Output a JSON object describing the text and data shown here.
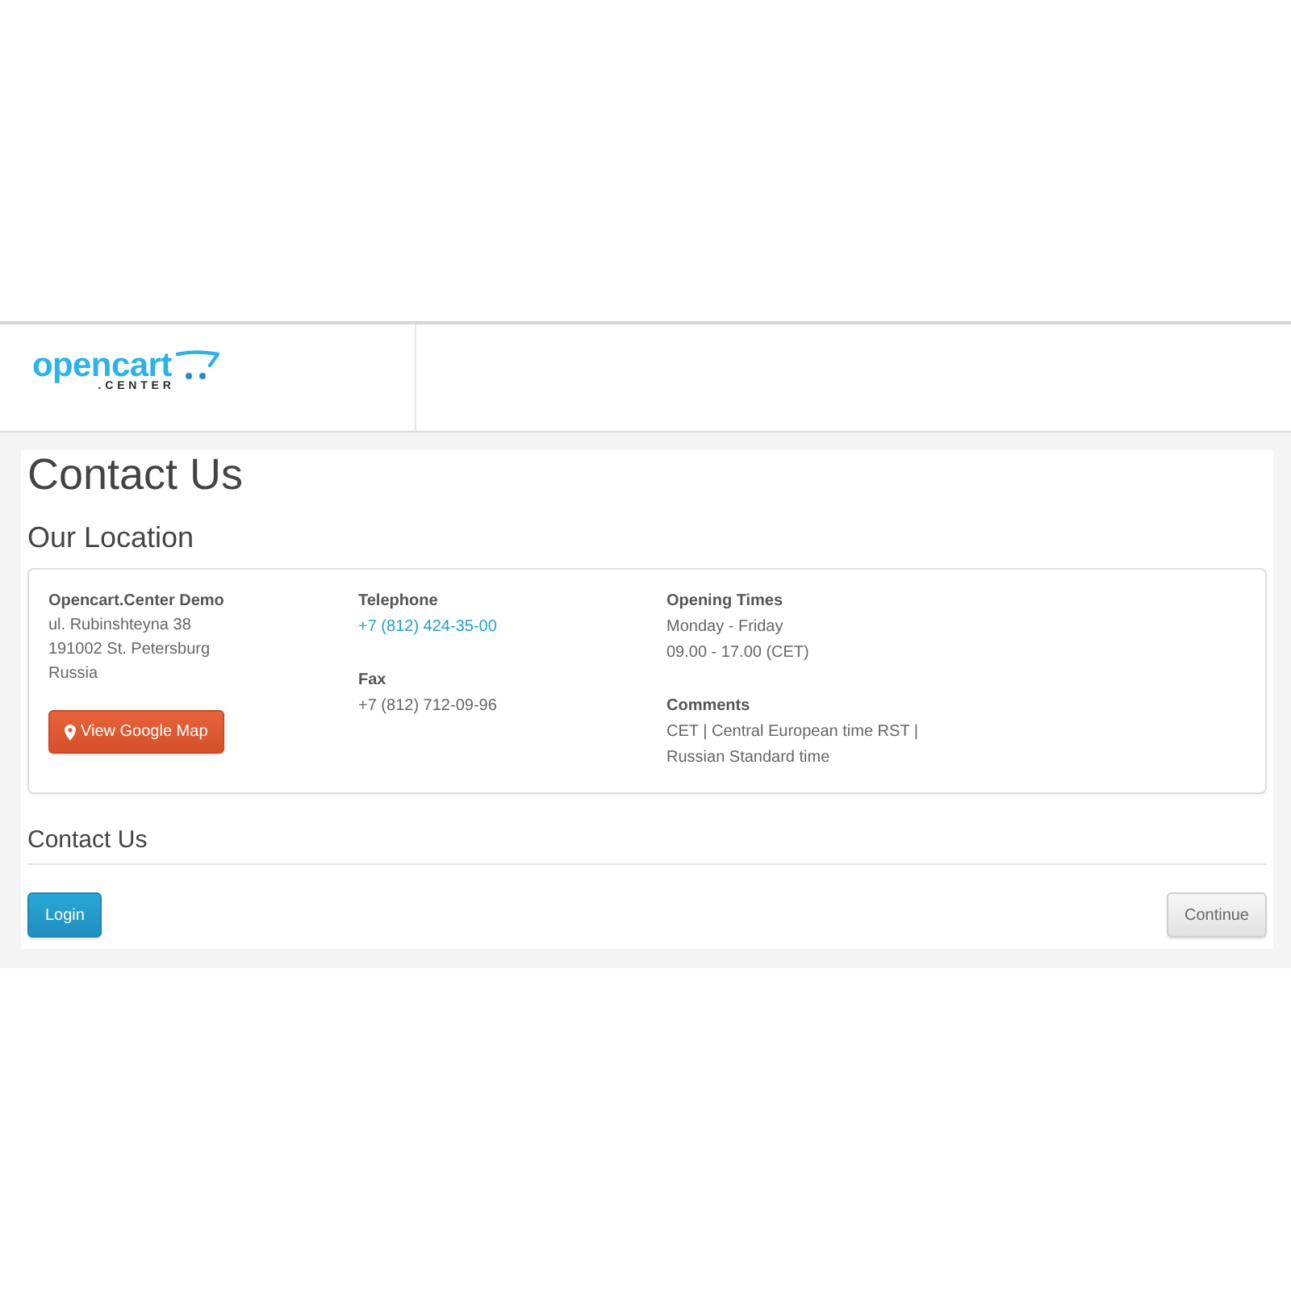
{
  "header": {
    "logo": {
      "wordmark": "opencart",
      "subtitle": ".CENTER"
    }
  },
  "page": {
    "title": "Contact Us",
    "location_heading": "Our Location"
  },
  "location": {
    "store": {
      "name": "Opencart.Center Demo",
      "address": [
        "ul. Rubinshteyna 38",
        "191002 St. Petersburg",
        "Russia"
      ],
      "map_button": "View Google Map"
    },
    "telephone": {
      "label": "Telephone",
      "value": "+7 (812) 424-35-00"
    },
    "fax": {
      "label": "Fax",
      "value": "+7 (812) 712-09-96"
    },
    "opening_times": {
      "label": "Opening Times",
      "lines": [
        "Monday - Friday",
        "09.00 - 17.00 (CET)"
      ]
    },
    "comments": {
      "label": "Comments",
      "text": "CET | Central European time RST | Russian Standard time"
    }
  },
  "form": {
    "legend": "Contact Us"
  },
  "buttons": [
    {
      "kind": "primary",
      "label": "Login"
    },
    {
      "kind": "default",
      "label": "Continue"
    }
  ]
}
